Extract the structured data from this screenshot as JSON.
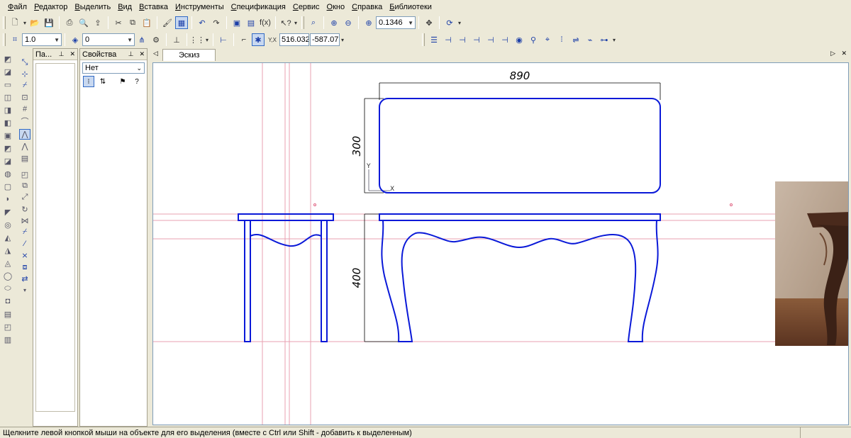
{
  "menu": {
    "items": [
      "Файл",
      "Редактор",
      "Выделить",
      "Вид",
      "Вставка",
      "Инструменты",
      "Спецификация",
      "Сервис",
      "Окно",
      "Справка",
      "Библиотеки"
    ]
  },
  "toolbar": {
    "zoom_value": "0.1346",
    "line_scale": "1.0",
    "layer_value": "0",
    "coord_x": "516.032",
    "coord_y": "-587.07"
  },
  "left_panel": {
    "title": "Па..."
  },
  "properties_panel": {
    "title": "Свойства",
    "selected": "Нет"
  },
  "document": {
    "tab_label": "Эскиз"
  },
  "drawing": {
    "dim_width": "890",
    "dim_top_height": "300",
    "dim_front_height": "400",
    "axis_y_label": "Y",
    "axis_x_label": "X",
    "line_color": "#0a19d8",
    "construction_color": "#e8a0b0",
    "reference_photo": "carved wooden table leg photo"
  },
  "status_bar": {
    "message": "Щелкните левой кнопкой мыши на объекте для его выделения (вместе с Ctrl или Shift - добавить к выделенным)"
  }
}
